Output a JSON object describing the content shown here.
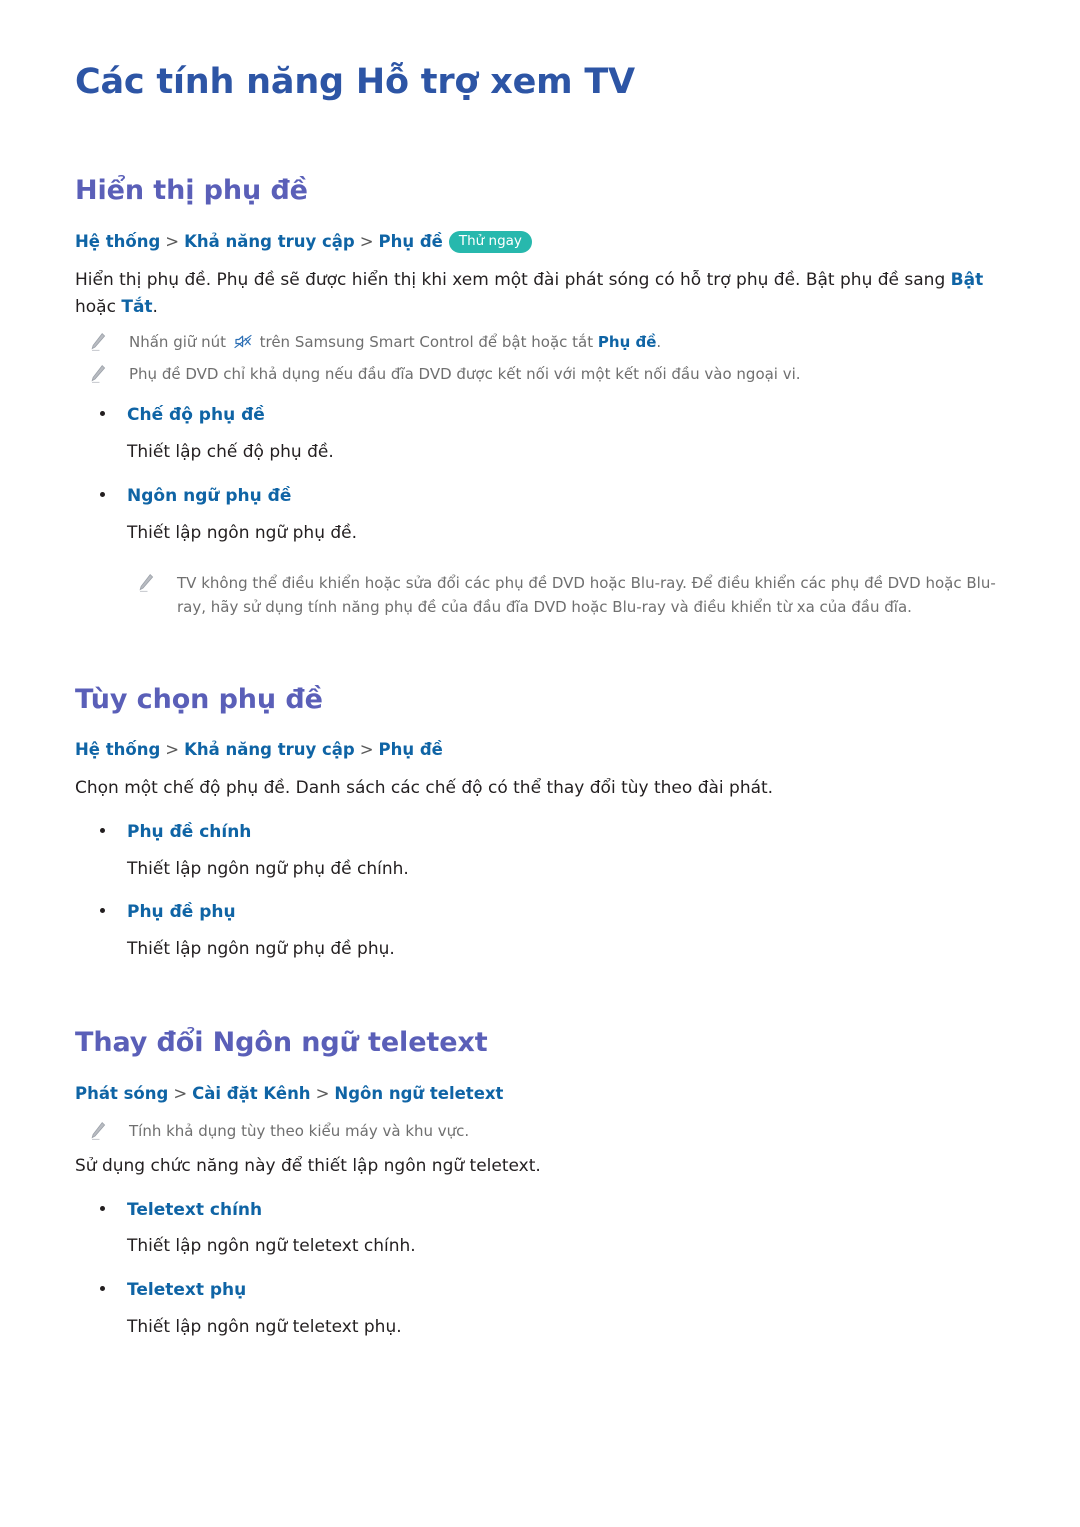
{
  "page": {
    "title": "Các tính năng Hỗ trợ xem TV",
    "language": "vi"
  },
  "colors": {
    "page_title": "#2d55a5",
    "section_title": "#5a5fb8",
    "link_blue": "#0f64a5",
    "badge_teal": "#27b8ad",
    "note_grey": "#6f6f6f",
    "body_black": "#231f20"
  },
  "sections": [
    {
      "id": "hien-thi-phu-de",
      "title": "Hiển thị phụ đề",
      "breadcrumb": {
        "crumbs": [
          "Hệ thống",
          "Khả năng truy cập",
          "Phụ đề"
        ],
        "separator": ">",
        "badge": "Thử ngay"
      },
      "paragraph": {
        "part1": "Hiển thị phụ đề. Phụ đề sẽ được hiển thị khi xem một đài phát sóng có hỗ trợ phụ đề. Bật phụ đề sang ",
        "bold1": "Bật",
        "part2": " hoặc ",
        "bold2": "Tắt",
        "part3": "."
      },
      "notes": [
        {
          "icon": "pencil-icon",
          "text_before": "Nhấn giữ nút ",
          "inline_icon": "mute-icon",
          "text_after": " trên Samsung Smart Control để bật hoặc tắt ",
          "bold": "Phụ đề",
          "text_end": "."
        },
        {
          "icon": "pencil-icon",
          "text_before": "Phụ đề DVD chỉ khả dụng nếu đầu đĩa DVD được kết nối với một kết nối đầu vào ngoại vi.",
          "inline_icon": "",
          "text_after": "",
          "bold": "",
          "text_end": ""
        }
      ],
      "bullets": [
        {
          "label": "Chế độ phụ đề",
          "desc": "Thiết lập chế độ phụ đề."
        },
        {
          "label": "Ngôn ngữ phụ đề",
          "desc": "Thiết lập ngôn ngữ phụ đề."
        }
      ],
      "trailing_note": {
        "icon": "pencil-icon",
        "text": "TV không thể điều khiển hoặc sửa đổi các phụ đề DVD hoặc Blu-ray. Để điều khiển các phụ đề DVD hoặc Blu-ray, hãy sử dụng tính năng phụ đề của đầu đĩa DVD hoặc Blu-ray và điều khiển từ xa của đầu đĩa."
      }
    },
    {
      "id": "tuy-chon-phu-de",
      "title": "Tùy chọn phụ đề",
      "breadcrumb": {
        "crumbs": [
          "Hệ thống",
          "Khả năng truy cập",
          "Phụ đề"
        ],
        "separator": ">",
        "badge": ""
      },
      "paragraph": {
        "part1": "Chọn một chế độ phụ đề. Danh sách các chế độ có thể thay đổi tùy theo đài phát.",
        "bold1": "",
        "part2": "",
        "bold2": "",
        "part3": ""
      },
      "bullets": [
        {
          "label": "Phụ đề chính",
          "desc": "Thiết lập ngôn ngữ phụ đề chính."
        },
        {
          "label": "Phụ đề phụ",
          "desc": "Thiết lập ngôn ngữ phụ đề phụ."
        }
      ]
    },
    {
      "id": "thay-doi-ngon-ngu-teletext",
      "title": "Thay đổi Ngôn ngữ teletext",
      "breadcrumb": {
        "crumbs": [
          "Phát sóng",
          "Cài đặt Kênh",
          "Ngôn ngữ teletext"
        ],
        "separator": ">",
        "badge": ""
      },
      "note": {
        "icon": "pencil-icon",
        "text": "Tính khả dụng tùy theo kiểu máy và khu vực."
      },
      "paragraph": {
        "part1": "Sử dụng chức năng này để thiết lập ngôn ngữ teletext.",
        "bold1": "",
        "part2": "",
        "bold2": "",
        "part3": ""
      },
      "bullets": [
        {
          "label": "Teletext chính",
          "desc": "Thiết lập ngôn ngữ teletext chính."
        },
        {
          "label": "Teletext phụ",
          "desc": "Thiết lập ngôn ngữ teletext phụ."
        }
      ]
    }
  ]
}
